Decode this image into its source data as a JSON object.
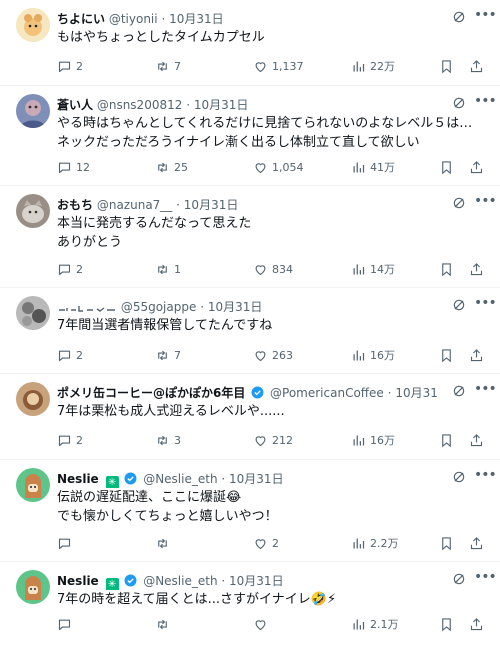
{
  "colors": {
    "text": "#0f1419",
    "muted": "#536471",
    "divider": "#eff3f4",
    "verified": "#1d9bf0",
    "green_badge": "#00ba7c"
  },
  "icons": {
    "reply": "speech-bubble-icon",
    "retweet": "repost-icon",
    "like": "heart-icon",
    "views": "bar-chart-icon",
    "bookmark": "bookmark-icon",
    "share": "upload-icon",
    "grok": "grok-icon",
    "more": "ellipsis-icon"
  },
  "replies": [
    {
      "name": "ちよにい",
      "handle": "@tiyonii",
      "date": "10月31日",
      "text": "もはやちょっとしたタイムカプセル",
      "replies": "2",
      "reposts": "7",
      "likes": "1,137",
      "views": "22万"
    },
    {
      "name": "蒼い人",
      "handle": "@nsns200812",
      "date": "10月31日",
      "text": "やる時はちゃんとしてくれるだけに見捨てられないのよなレベル５は…\nネックだっただろうイナイレ漸く出るし体制立て直して欲しい",
      "replies": "12",
      "reposts": "25",
      "likes": "1,054",
      "views": "41万"
    },
    {
      "name": "おもち",
      "handle": "@nazuna7__",
      "date": "10月31日",
      "text": "本当に発売するんだなって思えた\nありがとう",
      "replies": "2",
      "reposts": "1",
      "likes": "834",
      "views": "14万"
    },
    {
      "name": "",
      "handle": "@55gojappe",
      "date": "10月31日",
      "text": "7年間当選者情報保管してたんですね",
      "replies": "2",
      "reposts": "7",
      "likes": "263",
      "views": "16万"
    },
    {
      "name": "ポメリ缶コーヒー@ぽかぽか6年目",
      "handle": "@PomericanCoffee",
      "date": "10月31日",
      "text": "7年は栗松も成人式迎えるレベルや......",
      "replies": "2",
      "reposts": "3",
      "likes": "212",
      "views": "16万"
    },
    {
      "name": "Neslie",
      "handle": "@Neslie_eth",
      "date": "10月31日",
      "text": "伝説の遅延配達、ここに爆誕😂\nでも懐かしくてちょっと嬉しいやつ！",
      "replies": "",
      "reposts": "",
      "likes": "2",
      "views": "2.2万"
    },
    {
      "name": "Neslie",
      "handle": "@Neslie_eth",
      "date": "10月31日",
      "text": "7年の時を超えて届くとは...さすがイナイレ🤣⚡",
      "replies": "",
      "reposts": "",
      "likes": "",
      "views": "2.1万"
    }
  ]
}
